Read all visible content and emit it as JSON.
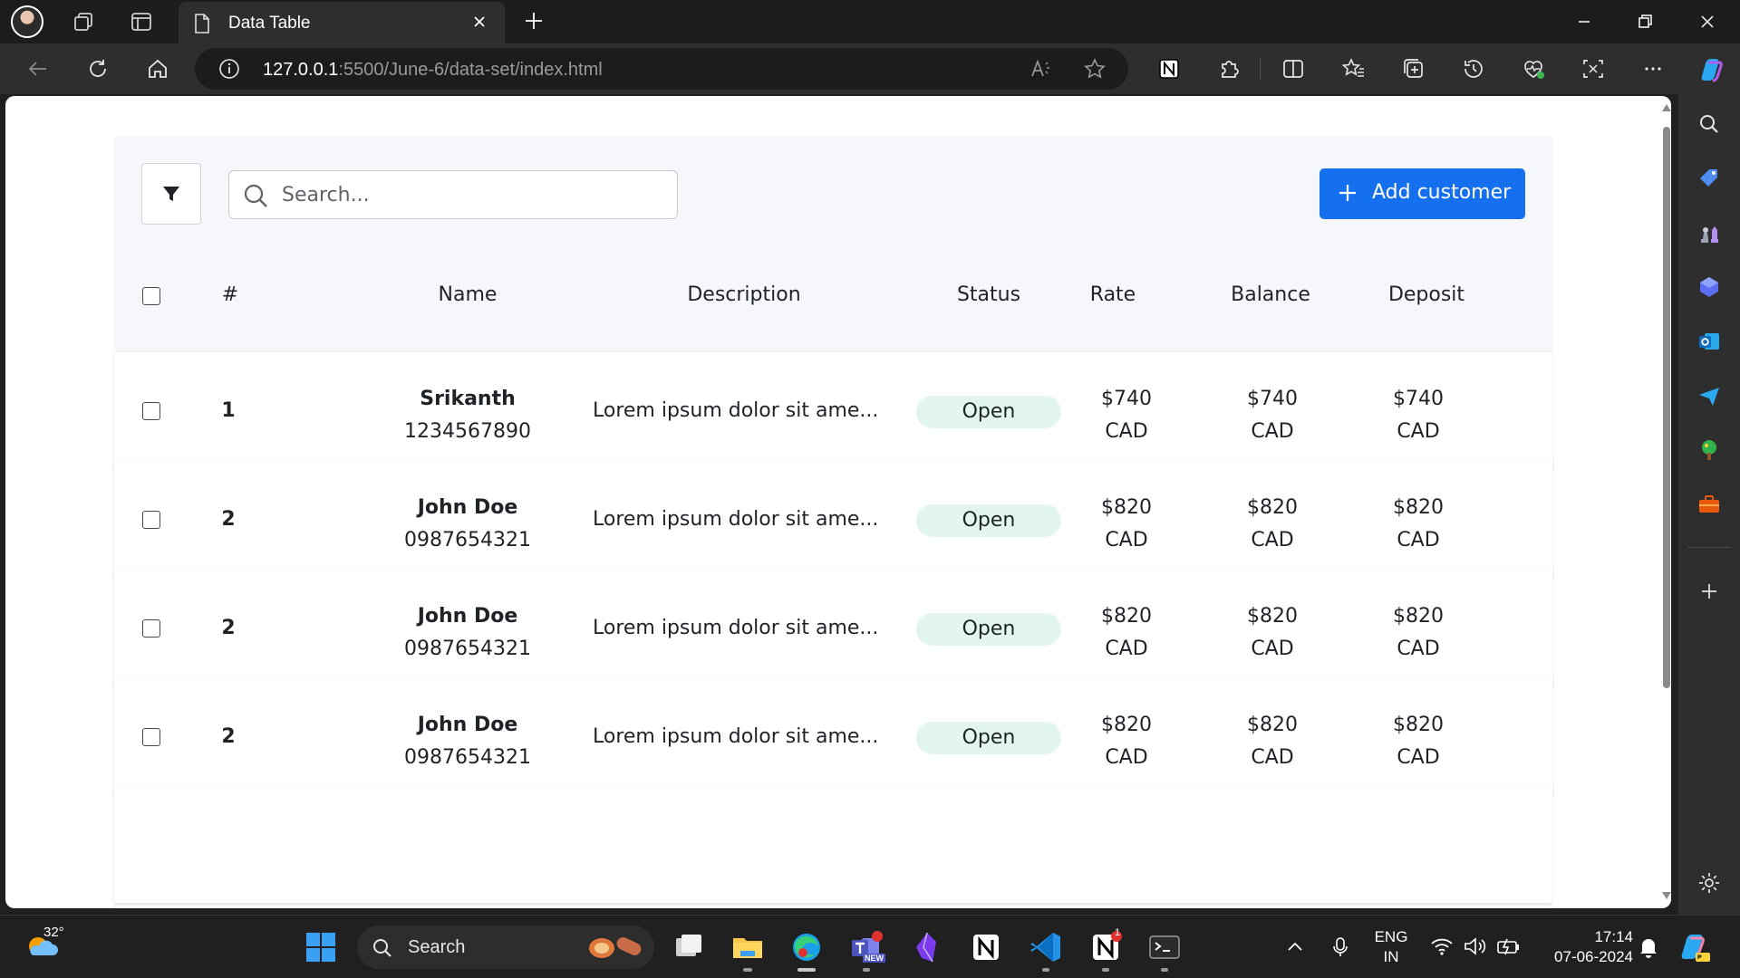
{
  "browser": {
    "tab_title": "Data Table",
    "url_host": "127.0.0.1",
    "url_rest": ":5500/June-6/data-set/index.html"
  },
  "toolbar": {
    "search_placeholder": "Search...",
    "add_label": "Add customer"
  },
  "table": {
    "headers": {
      "index": "#",
      "name": "Name",
      "description": "Description",
      "status": "Status",
      "rate": "Rate",
      "balance": "Balance",
      "deposit": "Deposit"
    },
    "rows": [
      {
        "index": "1",
        "name": "Srikanth",
        "phone": "1234567890",
        "description": "Lorem ipsum dolor sit ame...",
        "status": "Open",
        "rate": "$740",
        "rate_cur": "CAD",
        "balance": "$740",
        "balance_cur": "CAD",
        "deposit": "$740",
        "deposit_cur": "CAD"
      },
      {
        "index": "2",
        "name": "John Doe",
        "phone": "0987654321",
        "description": "Lorem ipsum dolor sit ame...",
        "status": "Open",
        "rate": "$820",
        "rate_cur": "CAD",
        "balance": "$820",
        "balance_cur": "CAD",
        "deposit": "$820",
        "deposit_cur": "CAD"
      },
      {
        "index": "2",
        "name": "John Doe",
        "phone": "0987654321",
        "description": "Lorem ipsum dolor sit ame...",
        "status": "Open",
        "rate": "$820",
        "rate_cur": "CAD",
        "balance": "$820",
        "balance_cur": "CAD",
        "deposit": "$820",
        "deposit_cur": "CAD"
      },
      {
        "index": "2",
        "name": "John Doe",
        "phone": "0987654321",
        "description": "Lorem ipsum dolor sit ame...",
        "status": "Open",
        "rate": "$820",
        "rate_cur": "CAD",
        "balance": "$820",
        "balance_cur": "CAD",
        "deposit": "$820",
        "deposit_cur": "CAD"
      }
    ]
  },
  "taskbar": {
    "weather_temp": "32°",
    "search_label": "Search",
    "lang_top": "ENG",
    "lang_bottom": "IN",
    "time": "17:14",
    "date": "07-06-2024",
    "teams_badge": "NEW",
    "notion_badge": "1"
  },
  "colors": {
    "accent": "#1570ef",
    "status_bg": "#e2f6ee",
    "panel_bg": "#f5f7fa"
  }
}
